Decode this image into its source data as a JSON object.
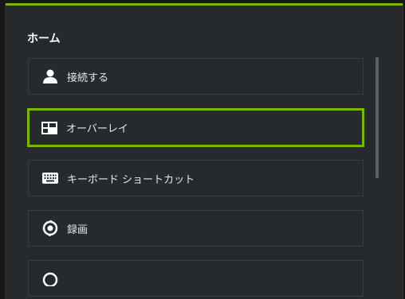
{
  "panel": {
    "title": "ホーム"
  },
  "menu": [
    {
      "label": "接続する",
      "icon": "person-icon"
    },
    {
      "label": "オーバーレイ",
      "icon": "overlay-layout-icon",
      "selected": true
    },
    {
      "label": "キーボード ショートカット",
      "icon": "keyboard-icon"
    },
    {
      "label": "録画",
      "icon": "record-icon"
    },
    {
      "label": "",
      "icon": "partial-icon"
    }
  ],
  "colors": {
    "accent": "#76b900",
    "panel_bg": "#272a2d",
    "text": "#e8e8e8"
  }
}
